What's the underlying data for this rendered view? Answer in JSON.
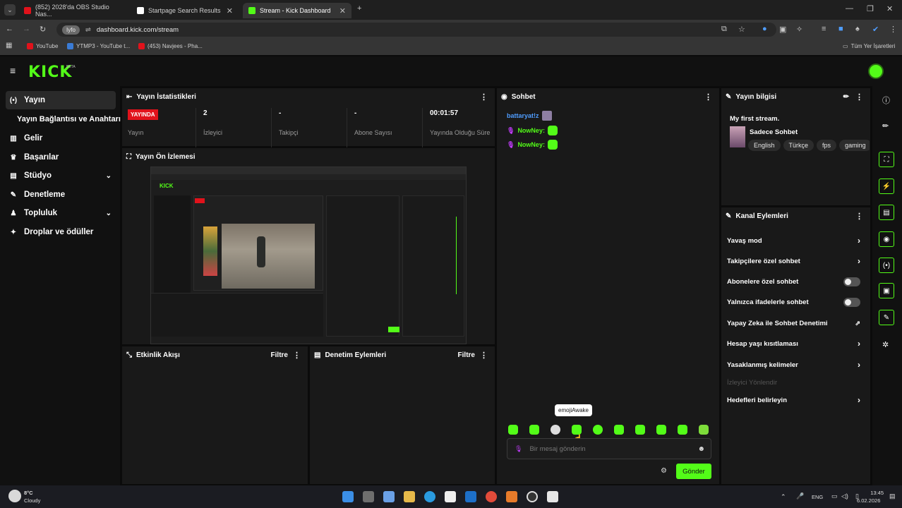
{
  "browser": {
    "tabs": [
      {
        "label": "(852) 2028'da OBS Studio Nas...",
        "active": false,
        "color": "#e1121b"
      },
      {
        "label": "Startpage Search Results",
        "active": false,
        "color": "#ffffff"
      },
      {
        "label": "Stream - Kick Dashboard",
        "active": true,
        "color": "#53fc18"
      }
    ],
    "url_chip": "Iyfo",
    "url": "dashboard.kick.com/stream",
    "bookmarks": [
      {
        "label": "YouTube",
        "color": "#e1121b"
      },
      {
        "label": "YTMP3 - YouTube t...",
        "color": "#3a7bd5"
      },
      {
        "label": "(453) Navjees - Pha...",
        "color": "#e1121b"
      }
    ],
    "all_bookmarks": "Tüm Yer İşaretleri"
  },
  "app": {
    "logo": "KICK",
    "logo_tag": "BETA"
  },
  "sidebar": {
    "items": [
      {
        "label": "Yayın",
        "icon": "broadcast-icon",
        "glyph": "(•)"
      },
      {
        "label": "Yayın Bağlantısı ve Anahtarı",
        "icon": "",
        "glyph": ""
      },
      {
        "label": "Gelir",
        "icon": "chart-icon",
        "glyph": "▥"
      },
      {
        "label": "Başarılar",
        "icon": "trophy-icon",
        "glyph": "♛"
      },
      {
        "label": "Stüdyo",
        "icon": "studio-icon",
        "glyph": "▤"
      },
      {
        "label": "Denetleme",
        "icon": "wrench-icon",
        "glyph": "✎"
      },
      {
        "label": "Topluluk",
        "icon": "people-icon",
        "glyph": "♟"
      },
      {
        "label": "Droplar ve ödüller",
        "icon": "gift-icon",
        "glyph": "✦"
      }
    ]
  },
  "stats": {
    "title": "Yayın İstatistikleri",
    "items": [
      {
        "value": "YAYINDA",
        "label": "Yayın"
      },
      {
        "value": "2",
        "label": "İzleyici"
      },
      {
        "value": "-",
        "label": "Takipçi"
      },
      {
        "value": "-",
        "label": "Abone Sayısı"
      },
      {
        "value": "00:01:57",
        "label": "Yayında Olduğu Süre"
      }
    ]
  },
  "preview": {
    "title": "Yayın Ön İzlemesi"
  },
  "activity": {
    "title": "Etkinlik Akışı",
    "filter": "Filtre"
  },
  "moderation": {
    "title": "Denetim Eylemleri",
    "filter": "Filtre"
  },
  "chat": {
    "title": "Sohbet",
    "messages": [
      {
        "user": "battaryat!z",
        "color": "#4f9dff"
      },
      {
        "user": "NowNey:",
        "color": "#53fc18"
      },
      {
        "user": "NowNey:",
        "color": "#53fc18"
      }
    ],
    "tooltip": "emojiAwake",
    "placeholder": "Bir mesaj gönderin",
    "send": "Gönder"
  },
  "info": {
    "title": "Yayın bilgisi",
    "stream_title": "My first stream.",
    "category": "Sadece Sohbet",
    "tags": [
      "English",
      "Türkçe",
      "fps",
      "gaming"
    ]
  },
  "channel_actions": {
    "title": "Kanal Eylemleri",
    "items": [
      {
        "label": "Yavaş mod",
        "control": "arrow"
      },
      {
        "label": "Takipçilere özel sohbet",
        "control": "arrow"
      },
      {
        "label": "Abonelere özel sohbet",
        "control": "toggle"
      },
      {
        "label": "Yalnızca ifadelerle sohbet",
        "control": "toggle"
      },
      {
        "label": "Yapay Zeka ile Sohbet Denetimi",
        "control": "chart"
      },
      {
        "label": "Hesap yaşı kısıtlaması",
        "control": "arrow"
      },
      {
        "label": "Yasaklanmış kelimeler",
        "control": "arrow"
      },
      {
        "label": "İzleyici Yönlendir",
        "control": "disabled"
      },
      {
        "label": "Hedefleri belirleyin",
        "control": "arrow"
      }
    ]
  },
  "taskbar": {
    "weather_temp": "8°C",
    "weather_text": "Cloudy",
    "lang": "ENG",
    "time": "13:45",
    "date": "6.02.2026"
  }
}
